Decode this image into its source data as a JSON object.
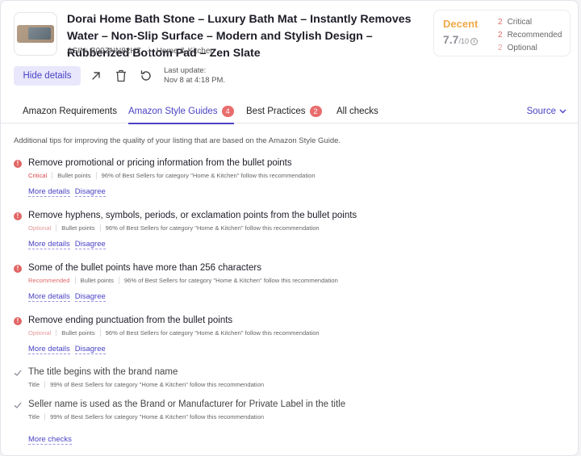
{
  "product": {
    "title": "Dorai Home Bath Stone – Luxury Bath Mat – Instantly Removes Water – Non-Slip Surface – Modern and Stylish Design – Rubberized Bottom Pad – Zen Slate",
    "asin": "ASIN: B09ZNN82HZ",
    "category": "Home & Kitchen"
  },
  "score": {
    "label": "Decent",
    "value": "7.7",
    "out_of": "/10",
    "critical_count": "2",
    "critical_label": "Critical",
    "recommended_count": "2",
    "recommended_label": "Recommended",
    "optional_count": "2",
    "optional_label": "Optional"
  },
  "actions": {
    "hide_details": "Hide details",
    "last_update_label": "Last update:",
    "last_update_value": "Nov 8 at 4:18 PM."
  },
  "tabs": [
    {
      "label": "Amazon Requirements",
      "badge": ""
    },
    {
      "label": "Amazon Style Guides",
      "badge": "4"
    },
    {
      "label": "Best Practices",
      "badge": "2"
    },
    {
      "label": "All checks",
      "badge": ""
    }
  ],
  "source_label": "Source",
  "intro": "Additional tips for improving the quality of your listing that are based on the Amazon Style Guide.",
  "checks": [
    {
      "title": "Remove promotional or pricing information from the bullet points",
      "severity": "Critical",
      "section": "Bullet points",
      "stat": "96% of Best Sellers for category \"Home & Kitchen\" follow this recommendation",
      "more": "More details",
      "disagree": "Disagree"
    },
    {
      "title": "Remove hyphens, symbols, periods, or exclamation points from the bullet points",
      "severity": "Optional",
      "section": "Bullet points",
      "stat": "96% of Best Sellers for category \"Home & Kitchen\" follow this recommendation",
      "more": "More details",
      "disagree": "Disagree"
    },
    {
      "title": "Some of the bullet points have more than 256 characters",
      "severity": "Recommended",
      "section": "Bullet points",
      "stat": "96% of Best Sellers for category \"Home & Kitchen\" follow this recommendation",
      "more": "More details",
      "disagree": "Disagree"
    },
    {
      "title": "Remove ending punctuation from the bullet points",
      "severity": "Optional",
      "section": "Bullet points",
      "stat": "96% of Best Sellers for category \"Home & Kitchen\" follow this recommendation",
      "more": "More details",
      "disagree": "Disagree"
    }
  ],
  "passed": [
    {
      "title": "The title begins with the brand name",
      "section": "Title",
      "stat": "99% of Best Sellers for category \"Home & Kitchen\" follow this recommendation"
    },
    {
      "title": "Seller name is used as the Brand or Manufacturer for Private Label in the title",
      "section": "Title",
      "stat": "99% of Best Sellers for category \"Home & Kitchen\" follow this recommendation"
    }
  ],
  "more_checks": "More checks",
  "colors": {
    "accent": "#4a43c4",
    "critical": "#e26464",
    "decent": "#f0a94a"
  }
}
